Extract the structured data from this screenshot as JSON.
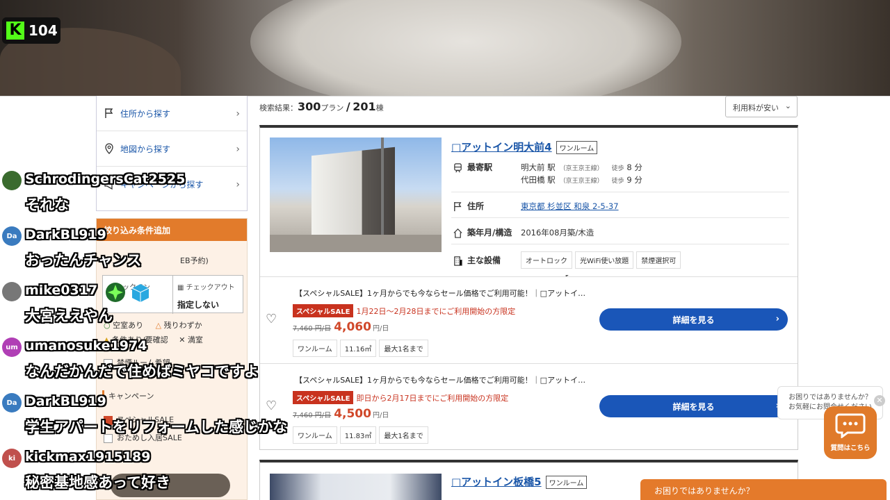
{
  "stream": {
    "platform_logo": "K",
    "viewer_count": "104"
  },
  "sidebar": {
    "items": [
      {
        "label": "住所から探す",
        "icon": "flag-icon"
      },
      {
        "label": "地図から探す",
        "icon": "map-pin-icon"
      },
      {
        "label": "キャンペーンから探す",
        "icon": "megaphone-icon"
      }
    ],
    "chevron": "›"
  },
  "filter": {
    "header": "絞り込み条件追加",
    "web_label": "EB予約)",
    "checkin_label_partial": "チェックイン",
    "checkout_label": "チェックアウト",
    "checkout_value": "指定しない",
    "legend": [
      "空室あり",
      "残りわずか",
      "条件あり/要確認",
      "満室"
    ],
    "room_label": "禁煙ルーム希望",
    "campaign_heading": "キャンペーン",
    "campaign_options": [
      {
        "label": "スペシャルSALE",
        "checked": true
      },
      {
        "label": "おためし入居SALE",
        "checked": false
      }
    ]
  },
  "results": {
    "label": "検索結果：",
    "plans": "300",
    "plans_unit": "プラン",
    "slash": "/",
    "buildings": "201",
    "buildings_unit": "棟",
    "sort_value": "利用料が安い"
  },
  "listing1": {
    "title": "□アットイン明大前4",
    "room_type": "ワンルーム",
    "station_label": "最寄駅",
    "stations": [
      {
        "name": "明大前 駅",
        "line": "（京王京王線）",
        "walk": "徒歩",
        "min": "8 分"
      },
      {
        "name": "代田橋 駅",
        "line": "（京王京王線）",
        "walk": "徒歩",
        "min": "9 分"
      }
    ],
    "address_label": "住所",
    "address": "東京都 杉並区 和泉 2-5-37",
    "built_label": "築年月/構造",
    "built": "2016年08月築/木造",
    "facilities_label": "主な設備",
    "facilities": [
      "オートロック",
      "光WiFi使い放題",
      "禁煙選択可"
    ]
  },
  "plans": [
    {
      "name": "【スペシャルSALE】1ヶ月からでも今ならセール価格でご利用可能！｜□アットイ…",
      "sale_tag": "スペシャルSALE",
      "sale_period": "1月22日〜2月28日までにご利用開始の方限定",
      "old_price": "7,460 円/日",
      "price": "4,060",
      "unit": "円/日",
      "tags": [
        "ワンルーム",
        "11.16㎡",
        "最大1名まで"
      ],
      "button": "詳細を見る"
    },
    {
      "name": "【スペシャルSALE】1ヶ月からでも今ならセール価格でご利用可能！｜□アットイ…",
      "sale_tag": "スペシャルSALE",
      "sale_period": "即日から2月17日までにご利用開始の方限定",
      "old_price": "7,460 円/日",
      "price": "4,500",
      "unit": "円/日",
      "tags": [
        "ワンルーム",
        "11.83㎡",
        "最大1名まで"
      ],
      "button": "詳細を見る"
    }
  ],
  "listing2": {
    "title": "□アットイン板橋5",
    "room_type": "ワンルーム"
  },
  "chat": [
    {
      "user": "SchrodingersCat2525",
      "msg": "それな",
      "avatar": "",
      "color": "#3a6b2e"
    },
    {
      "user": "DarkBL919",
      "msg": "おったんチャンス",
      "avatar": "Da",
      "color": "#3a7bbf"
    },
    {
      "user": "mike0317",
      "msg": "大宮ええやん",
      "avatar": "",
      "color": "#777777"
    },
    {
      "user": "umanosuke1974",
      "msg": "なんだかんだで住めばミヤコですよ",
      "avatar": "um",
      "color": "#b03fb5"
    },
    {
      "user": "DarkBL919",
      "msg": "学生アパートをリフォームした感じかな",
      "avatar": "Da",
      "color": "#3a7bbf"
    },
    {
      "user": "kickmax1915189",
      "msg": "秘密基地感あって好き",
      "avatar": "ki",
      "color": "#c0504d"
    }
  ],
  "help": {
    "bubble_line1": "お困りではありませんか？",
    "bubble_line2": "お気軽にお問合せください",
    "close": "✕",
    "bot_label": "質問はこちら",
    "bar": "お困りではありませんか？"
  },
  "colors": {
    "accent_orange": "#e27b2b",
    "link_blue": "#1a56a8",
    "button_blue": "#1a56b8",
    "sale_red": "#c8321e",
    "kick_green": "#53fc18"
  }
}
